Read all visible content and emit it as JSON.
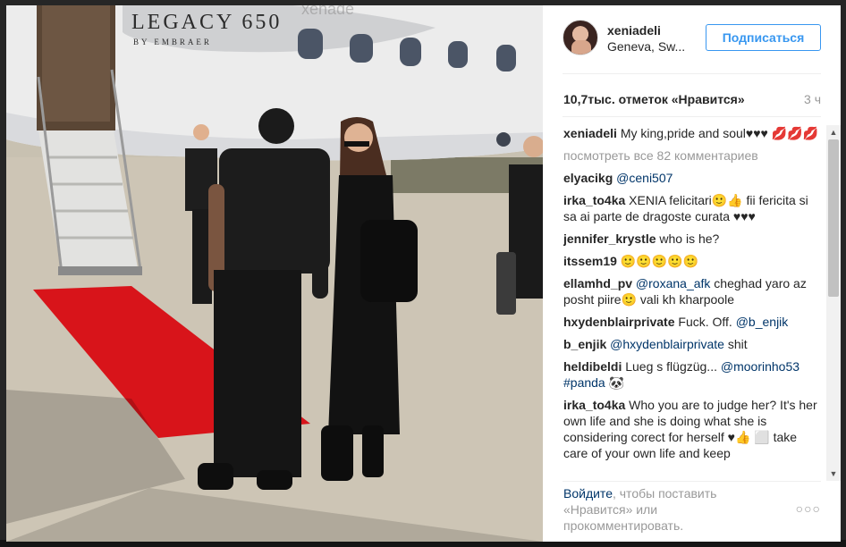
{
  "photo": {
    "jet_brand": "LEGACY 650",
    "jet_sub": "BY EMBRAER",
    "watermark": "xenade"
  },
  "post": {
    "username": "xeniadeli",
    "location": "Geneva, Sw...",
    "follow_label": "Подписаться",
    "likes": "10,7тыс. отметок «Нравится»",
    "time": "3 ч"
  },
  "caption": {
    "user": "xeniadeli",
    "text": "My king,pride and soul♥♥♥ 💋💋💋"
  },
  "view_all_comments": "посмотреть все 82 комментариев",
  "comments": [
    {
      "user": "elyacikg",
      "mention": "@ceni507",
      "text": ""
    },
    {
      "user": "irka_to4ka",
      "mention": "",
      "text": "XENIA felicitari🙂👍 fii fericita si sa ai parte de dragoste curata ♥♥♥"
    },
    {
      "user": "jennifer_krystle",
      "mention": "",
      "text": "who is he?"
    },
    {
      "user": "itssem19",
      "mention": "",
      "text": "🙂🙂🙂🙂🙂"
    },
    {
      "user": "ellamhd_pv",
      "mention": "@roxana_afk",
      "text": "cheghad yaro az posht piire🙂 vali kh kharpoole"
    },
    {
      "user": "hxydenblairprivate",
      "mention": "",
      "text": "Fuck. Off.",
      "mention_after": "@b_enjik"
    },
    {
      "user": "b_enjik",
      "mention": "@hxydenblairprivate",
      "text": "shit"
    },
    {
      "user": "heldibeldi",
      "mention": "",
      "text": "Lueg s flügzüg...",
      "mention_after": "@moorinho53 #panda 🐼"
    },
    {
      "user": "irka_to4ka",
      "mention": "",
      "text": "Who you are to judge her? It's her own life and she is doing what she is considering corect for herself ♥👍 ⬜ take care of your own life and keep"
    }
  ],
  "footer": {
    "login_link": "Войдите",
    "text": ", чтобы поставить «Нравится» или прокомментировать.",
    "more_label": "○○○"
  },
  "colors": {
    "accent": "#3897f0",
    "link": "#003569",
    "muted": "#999999",
    "carpet": "#d8141a"
  }
}
